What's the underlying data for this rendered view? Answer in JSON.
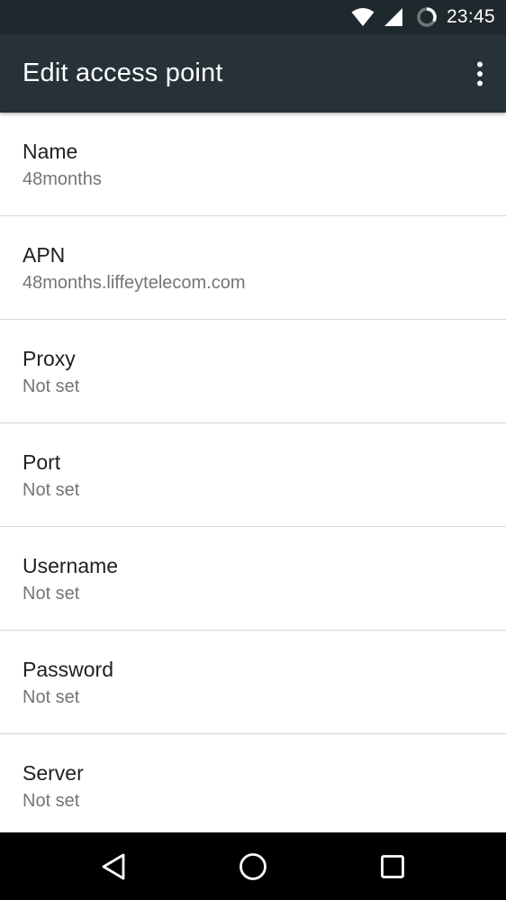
{
  "status_bar": {
    "time": "23:45",
    "icons": [
      "wifi-icon",
      "cell-signal-icon",
      "sync-icon"
    ]
  },
  "app_bar": {
    "title": "Edit access point",
    "overflow_icon": "more-vert-icon"
  },
  "preferences": [
    {
      "label": "Name",
      "value": "48months"
    },
    {
      "label": "APN",
      "value": "48months.liffeytelecom.com"
    },
    {
      "label": "Proxy",
      "value": "Not set"
    },
    {
      "label": "Port",
      "value": "Not set"
    },
    {
      "label": "Username",
      "value": "Not set"
    },
    {
      "label": "Password",
      "value": "Not set"
    },
    {
      "label": "Server",
      "value": "Not set"
    }
  ],
  "nav_bar": {
    "buttons": [
      "back-icon",
      "home-icon",
      "recents-icon"
    ]
  },
  "colors": {
    "status_bar": "#1f282d",
    "app_bar": "#263238",
    "divider": "#d6d6d6",
    "primary_text": "#212121",
    "secondary_text": "#757575"
  }
}
